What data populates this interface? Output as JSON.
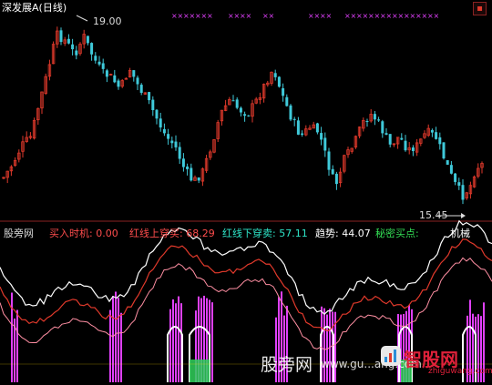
{
  "header": {
    "title": "深发展A",
    "period": "(日线)"
  },
  "colors": {
    "background": "#000000",
    "up": "#e0392b",
    "down": "#3fc9d9",
    "magenta": "#e040fb",
    "white": "#ffffff",
    "yellow": "#ffd700",
    "green": "#2fd05a",
    "cyan_label": "#2ee6c9"
  },
  "price_chart": {
    "high_label": "19.00",
    "low_label": "15.45"
  },
  "indicator": {
    "name": "股旁网",
    "items": [
      {
        "label": "买入时机:",
        "value": "0.00",
        "color": "#ff4d4d"
      },
      {
        "label": "红线上穿买:",
        "value": "68.29",
        "color": "#ff4d4d"
      },
      {
        "label": "红线下穿卖:",
        "value": "57.11",
        "color": "#2ee6c9"
      },
      {
        "label": "趋势:",
        "value": "44.07",
        "color": "#ffffff"
      },
      {
        "label": "秘密买点:",
        "value": "",
        "color": "#33dd55"
      }
    ],
    "tail_text": "机械"
  },
  "watermark": {
    "site1_cn": "股旁网",
    "site1_url": "www.gu...ang.com",
    "site2_cn": "智股网",
    "site2_url": "zhiguwang.com"
  },
  "chart_data": {
    "type": "candlestick",
    "price_extremes": {
      "high": 19.0,
      "low": 15.45
    },
    "indicator_values": {
      "买入时机": 0.0,
      "红线上穿买": 68.29,
      "红线下穿卖": 57.11,
      "趋势": 44.07
    }
  }
}
